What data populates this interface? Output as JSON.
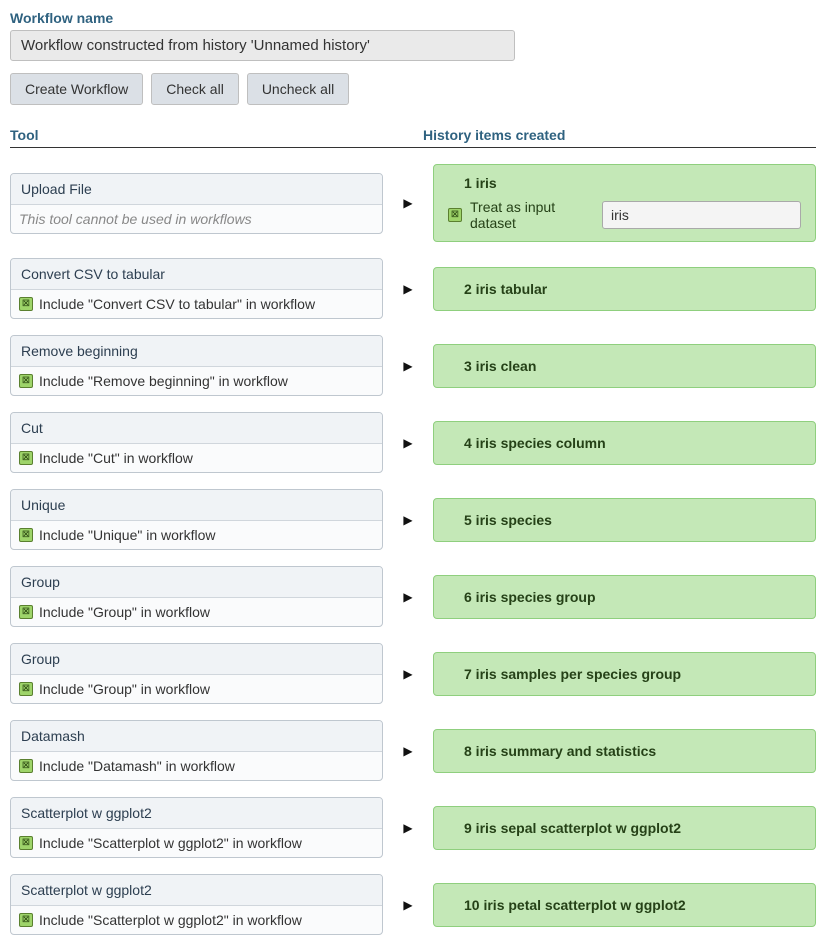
{
  "workflow_name_label": "Workflow name",
  "workflow_name_value": "Workflow constructed from history 'Unnamed history'",
  "buttons": {
    "create": "Create Workflow",
    "check_all": "Check all",
    "uncheck_all": "Uncheck all"
  },
  "headers": {
    "tool": "Tool",
    "history": "History items created"
  },
  "arrow_glyph": "▶",
  "check_glyph": "⊠",
  "upload": {
    "title": "Upload File",
    "note": "This tool cannot be used in workflows",
    "hist_label": "1 iris",
    "treat_label": "Treat as input dataset",
    "treat_value": "iris"
  },
  "rows": [
    {
      "tool": "Convert CSV to tabular",
      "include": "Include \"Convert CSV to tabular\" in workflow",
      "hist": "2 iris tabular"
    },
    {
      "tool": "Remove beginning",
      "include": "Include \"Remove beginning\" in workflow",
      "hist": "3 iris clean"
    },
    {
      "tool": "Cut",
      "include": "Include \"Cut\" in workflow",
      "hist": "4 iris species column"
    },
    {
      "tool": "Unique",
      "include": "Include \"Unique\" in workflow",
      "hist": "5 iris species"
    },
    {
      "tool": "Group",
      "include": "Include \"Group\" in workflow",
      "hist": "6 iris species group"
    },
    {
      "tool": "Group",
      "include": "Include \"Group\" in workflow",
      "hist": "7 iris samples per species group"
    },
    {
      "tool": "Datamash",
      "include": "Include \"Datamash\" in workflow",
      "hist": "8 iris summary and statistics"
    },
    {
      "tool": "Scatterplot w ggplot2",
      "include": "Include \"Scatterplot w ggplot2\" in workflow",
      "hist": "9 iris sepal scatterplot w ggplot2"
    },
    {
      "tool": "Scatterplot w ggplot2",
      "include": "Include \"Scatterplot w ggplot2\" in workflow",
      "hist": "10 iris petal scatterplot w ggplot2"
    }
  ]
}
